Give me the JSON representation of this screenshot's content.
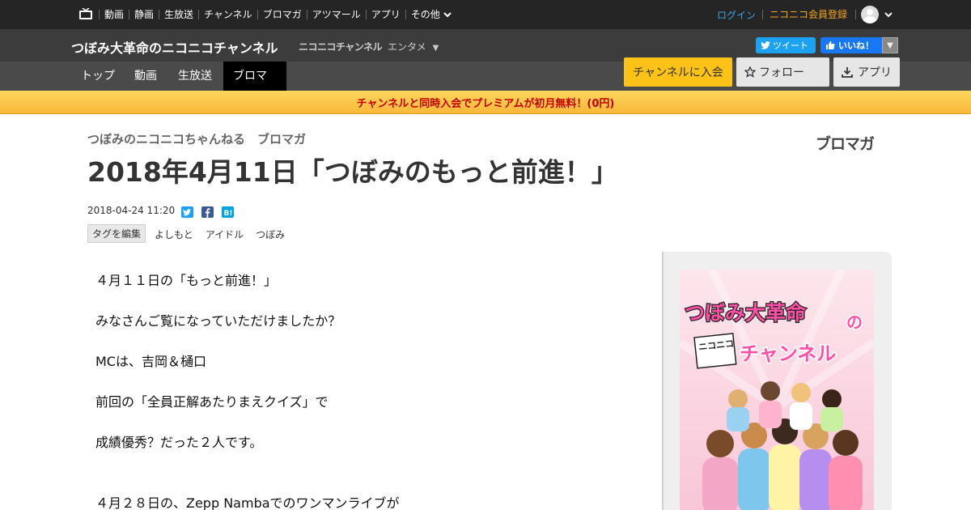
{
  "global_bar": {
    "nav": [
      "動画",
      "静画",
      "生放送",
      "チャンネル",
      "ブロマガ",
      "アツマール",
      "アプリ",
      "その他"
    ],
    "login": "ログイン",
    "register": "ニコニコ会員登録"
  },
  "channel_header": {
    "title": "つぼみ大革命のニコニコチャンネル",
    "brand": "ニコニコチャンネル",
    "category": "エンタメ",
    "tweet_label": "ツイート",
    "like_label": "いいね！"
  },
  "channel_nav": {
    "tabs": [
      "トップ",
      "動画",
      "生放送",
      "ブロマガ"
    ],
    "active_tab": "ブロマガ",
    "join_label": "チャンネルに入会",
    "follow_label": "フォロー",
    "app_label": "アプリ"
  },
  "promo": {
    "text": "チャンネルと同時入会でプレミアムが初月無料！(0円)"
  },
  "article": {
    "breadcrumb": "つぼみのニコニコちゃんねる　ブロマガ",
    "brand_logo": "ブロマガ",
    "title": "2018年4月11日「つぼみのもっと前進！」",
    "date": "2018-04-24 11:20",
    "tag_edit_label": "タグを編集",
    "tags": [
      "よしもと",
      "アイドル",
      "つぼみ"
    ],
    "paragraphs": [
      "４月１１日の「もっと前進！」",
      "みなさんご覧になっていただけましたか？",
      "MCは、吉岡＆樋口",
      "前回の「全員正解あたりまえクイズ」で",
      "成績優秀？だった２人です。",
      "４月２８日の、Zepp Nambaでのワンマンライブが"
    ]
  },
  "sidebar": {
    "thumbnail_line1": "つぼみ大革命",
    "thumbnail_no": "の",
    "thumbnail_niconico": "ニコニコ",
    "thumbnail_line2": "チャンネル"
  },
  "colors": {
    "join": "#fcc217",
    "promo_text": "#c70000",
    "login": "#3ba8e6",
    "register": "#f5a623"
  }
}
